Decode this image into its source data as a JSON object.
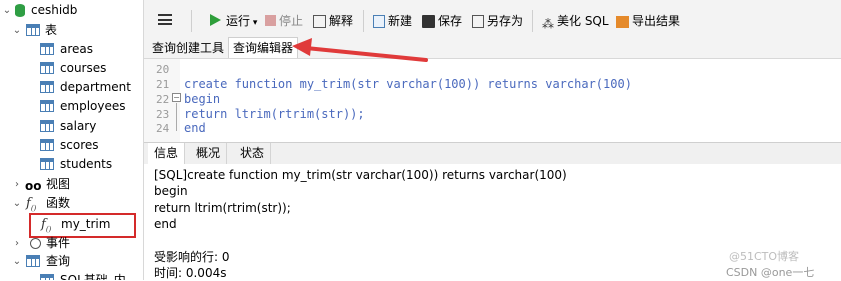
{
  "sidebar": {
    "db": "ceshidb",
    "tables_group": "表",
    "tables": [
      "areas",
      "courses",
      "department",
      "employees",
      "salary",
      "scores",
      "students"
    ],
    "views_group": "视图",
    "functions_group": "函数",
    "function_item": "my_trim",
    "events_group": "事件",
    "queries_group": "查询",
    "query_item": "SQL基础_内"
  },
  "toolbar": {
    "run": "运行",
    "stop": "停止",
    "explain": "解释",
    "new": "新建",
    "save": "保存",
    "save_as": "另存为",
    "beautify": "美化 SQL",
    "export": "导出结果"
  },
  "tabs": [
    "查询创建工具",
    "查询编辑器"
  ],
  "editor": {
    "line_numbers": [
      "20",
      "21",
      "22",
      "23",
      "24"
    ],
    "lines": [
      "",
      "create function my_trim(str varchar(100)) returns varchar(100)",
      "begin",
      "return ltrim(rtrim(str));",
      "end"
    ]
  },
  "result_tabs": [
    "信息",
    "概况",
    "状态"
  ],
  "result": {
    "lines": [
      "[SQL]create function my_trim(str varchar(100)) returns varchar(100)",
      "begin",
      "return ltrim(rtrim(str));",
      "end",
      "",
      "受影响的行: 0",
      "时间: 0.004s"
    ]
  },
  "watermark": {
    "line1": "@51CTO博客",
    "line2": "CSDN @one一七"
  },
  "colors": {
    "keyword": "#4a69bd",
    "highlight_box": "#d42a2a",
    "arrow": "#e03a3a"
  }
}
